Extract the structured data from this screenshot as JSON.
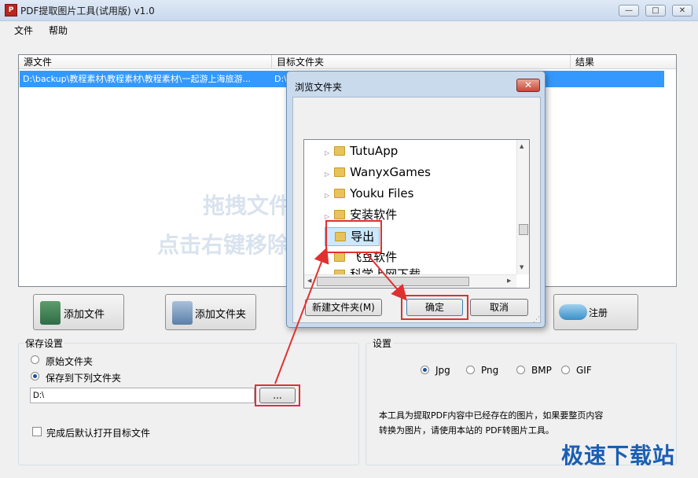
{
  "window": {
    "title": "PDF提取图片工具(试用版) v1.0",
    "app_icon_text": "P",
    "caption_buttons": [
      "—",
      "□",
      "✕"
    ]
  },
  "menu": [
    "文件",
    "帮助"
  ],
  "list": {
    "columns": [
      "源文件",
      "目标文件夹",
      "结果"
    ],
    "rows": [
      {
        "source": "D:\\backup\\教程素材\\教程素材\\教程素材\\一起游上海旅游...",
        "target": "D:\\",
        "result": ""
      }
    ],
    "watermark_line1": "拖拽文件",
    "watermark_line2": "点击右键移除"
  },
  "buttons": {
    "add_file": "添加文件",
    "add_folder": "添加文件夹",
    "register": "注册"
  },
  "save_settings": {
    "title": "保存设置",
    "option_original": "原始文件夹",
    "option_custom": "保存到下列文件夹",
    "selected": "custom",
    "path_value": "D:\\",
    "browse_label": "...",
    "open_after_label": "完成后默认打开目标文件",
    "open_after_checked": false
  },
  "settings": {
    "title": "设置",
    "formats": [
      "Jpg",
      "Png",
      "BMP",
      "GIF"
    ],
    "selected_format": "Jpg",
    "note_line1": "本工具为提取PDF内容中已经存在的图片，如果要整页内容",
    "note_line2": "转换为图片，请使用本站的 PDF转图片工具。"
  },
  "dialog": {
    "title": "浏览文件夹",
    "close_label": "✕",
    "tree_items": [
      "TutuApp",
      "WanyxGames",
      "Youku Files",
      "安装软件",
      "导出",
      "飞豆软件",
      "科学上网下载"
    ],
    "selected_item": "导出",
    "new_folder_label": "新建文件夹(M)",
    "ok_label": "确定",
    "cancel_label": "取消"
  },
  "brand_logo": "极速下载站",
  "colors": {
    "selection": "#3399ff",
    "highlight": "#e03030",
    "brand": "#1a5fb4"
  }
}
